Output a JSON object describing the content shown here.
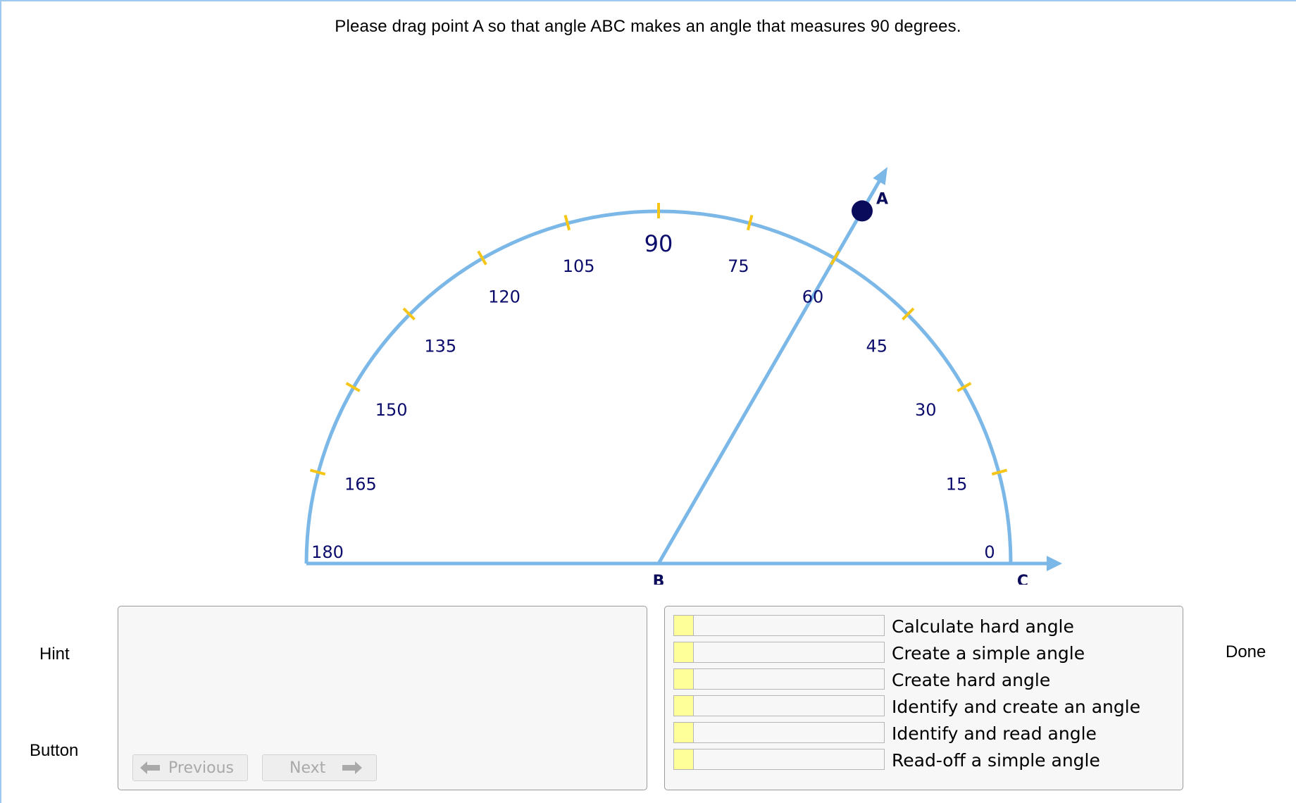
{
  "instruction": "Please drag point A so that angle ABC makes an angle that measures 90 degrees.",
  "protractor": {
    "tick_labels": [
      "0",
      "15",
      "30",
      "45",
      "60",
      "75",
      "90",
      "105",
      "120",
      "135",
      "150",
      "165",
      "180"
    ],
    "point_labels": {
      "a": "A",
      "b": "B",
      "c": "C"
    },
    "current_angle_deg": 60,
    "target_angle_deg": 90,
    "colors": {
      "arc": "#7bb8e8",
      "tick": "#f5c518",
      "label": "#0b0b6b",
      "point": "#0b0b5c"
    }
  },
  "hint": {
    "side_label": "Hint",
    "button_side_label": "Button",
    "previous_label": "Previous",
    "next_label": "Next",
    "previous_icon": "arrow-left-icon",
    "next_icon": "arrow-right-icon"
  },
  "done_label": "Done",
  "skills": [
    {
      "name": "Calculate hard angle",
      "progress": 0.09
    },
    {
      "name": "Create a simple angle",
      "progress": 0.09
    },
    {
      "name": "Create hard angle",
      "progress": 0.09
    },
    {
      "name": "Identify and create an angle",
      "progress": 0.09
    },
    {
      "name": "Identify and read angle",
      "progress": 0.09
    },
    {
      "name": "Read-off a simple angle",
      "progress": 0.09
    }
  ]
}
